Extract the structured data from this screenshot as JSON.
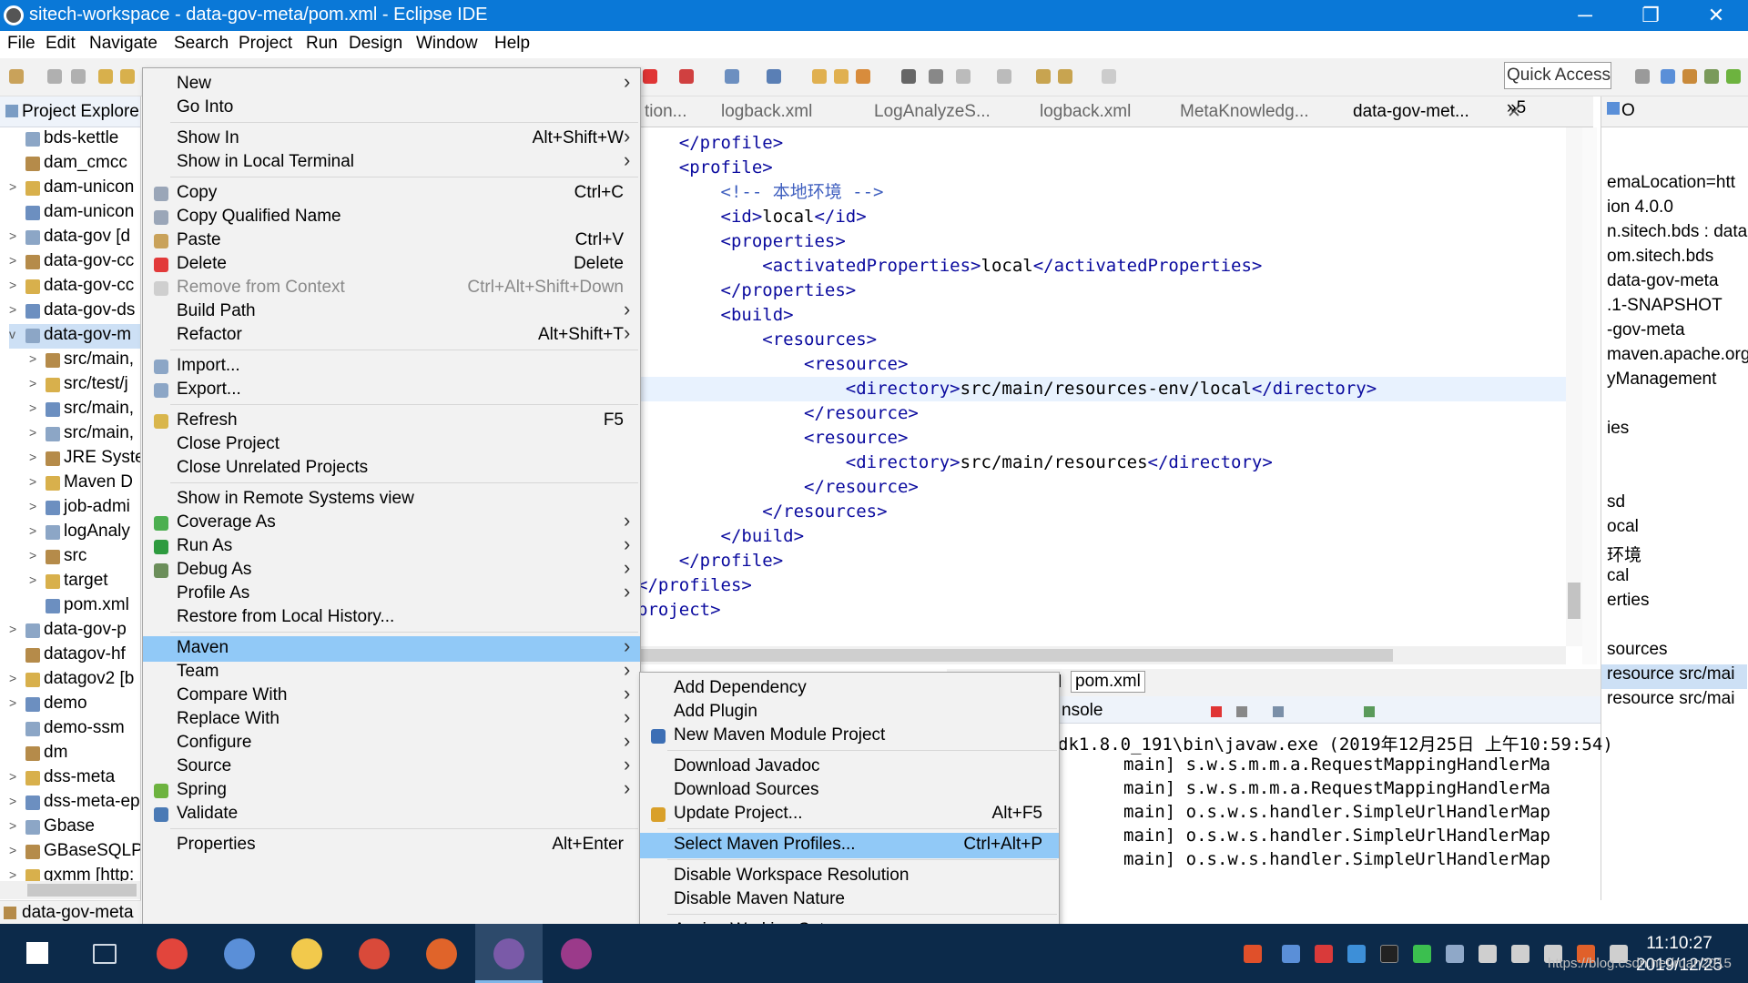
{
  "window": {
    "title": "sitech-workspace - data-gov-meta/pom.xml - Eclipse IDE",
    "minimize_glyph": "─",
    "restore_glyph": "❐",
    "close_glyph": "✕"
  },
  "menubar": [
    "File",
    "Edit",
    "Navigate",
    "Search",
    "Project",
    "Run",
    "Design",
    "Window",
    "Help"
  ],
  "toolbar": {
    "quick_access": "Quick Access"
  },
  "project_explorer": {
    "title": "Project Explore",
    "items": [
      {
        "label": "bds-kettle",
        "arrow": ""
      },
      {
        "label": "dam_cmcc",
        "arrow": ""
      },
      {
        "label": "dam-unicon",
        "arrow": ">"
      },
      {
        "label": "dam-unicon",
        "arrow": ""
      },
      {
        "label": "data-gov [d",
        "arrow": ">"
      },
      {
        "label": "data-gov-cc",
        "arrow": ">"
      },
      {
        "label": "data-gov-cc",
        "arrow": ">"
      },
      {
        "label": "data-gov-ds",
        "arrow": ">"
      },
      {
        "label": "data-gov-m",
        "arrow": "v"
      },
      {
        "label": "src/main,",
        "arrow": ">"
      },
      {
        "label": "src/test/j",
        "arrow": ">"
      },
      {
        "label": "src/main,",
        "arrow": ">"
      },
      {
        "label": "src/main,",
        "arrow": ">"
      },
      {
        "label": "JRE Syste",
        "arrow": ">"
      },
      {
        "label": "Maven D",
        "arrow": ">"
      },
      {
        "label": "job-admi",
        "arrow": ">"
      },
      {
        "label": "logAnaly",
        "arrow": ">"
      },
      {
        "label": "src",
        "arrow": ">"
      },
      {
        "label": "target",
        "arrow": ">"
      },
      {
        "label": "pom.xml",
        "arrow": ""
      },
      {
        "label": "data-gov-p",
        "arrow": ">"
      },
      {
        "label": "datagov-hf",
        "arrow": ""
      },
      {
        "label": "datagov2 [b",
        "arrow": ">"
      },
      {
        "label": "demo",
        "arrow": ">"
      },
      {
        "label": "demo-ssm",
        "arrow": ""
      },
      {
        "label": "dm",
        "arrow": ""
      },
      {
        "label": "dss-meta",
        "arrow": ">"
      },
      {
        "label": "dss-meta-ep",
        "arrow": ">"
      },
      {
        "label": "Gbase",
        "arrow": ">"
      },
      {
        "label": "GBaseSQLPa",
        "arrow": ">"
      },
      {
        "label": "gxmm [http:",
        "arrow": ">"
      }
    ],
    "status": "data-gov-meta"
  },
  "editor": {
    "tabs": [
      "tion...",
      "logback.xml",
      "LogAnalyzeS...",
      "logback.xml",
      "MetaKnowledg...",
      "data-gov-met..."
    ],
    "overflow": "»5",
    "lines": [
      {
        "indent": "    ",
        "parts": [
          [
            "tag",
            "</profile>"
          ]
        ]
      },
      {
        "indent": "    ",
        "parts": [
          [
            "tag",
            "<profile>"
          ]
        ]
      },
      {
        "indent": "        ",
        "parts": [
          [
            "cmt",
            "<!-- 本地环境 -->"
          ]
        ]
      },
      {
        "indent": "        ",
        "parts": [
          [
            "tag",
            "<id>"
          ],
          [
            "txt",
            "local"
          ],
          [
            "tag",
            "</id>"
          ]
        ]
      },
      {
        "indent": "        ",
        "parts": [
          [
            "tag",
            "<properties>"
          ]
        ]
      },
      {
        "indent": "            ",
        "parts": [
          [
            "tag",
            "<activatedProperties>"
          ],
          [
            "txt",
            "local"
          ],
          [
            "tag",
            "</activatedProperties>"
          ]
        ]
      },
      {
        "indent": "        ",
        "parts": [
          [
            "tag",
            "</properties>"
          ]
        ]
      },
      {
        "indent": "        ",
        "parts": [
          [
            "tag",
            "<build>"
          ]
        ]
      },
      {
        "indent": "            ",
        "parts": [
          [
            "tag",
            "<resources>"
          ]
        ]
      },
      {
        "indent": "                ",
        "parts": [
          [
            "tag",
            "<resource>"
          ]
        ]
      },
      {
        "indent": "                    ",
        "parts": [
          [
            "tag",
            "<directory>"
          ],
          [
            "txt",
            "src/main/resources-env/local"
          ],
          [
            "tag",
            "</directory>"
          ]
        ],
        "highlight": true
      },
      {
        "indent": "                ",
        "parts": [
          [
            "tag",
            "</resource>"
          ]
        ]
      },
      {
        "indent": "                ",
        "parts": [
          [
            "tag",
            "<resource>"
          ]
        ]
      },
      {
        "indent": "                    ",
        "parts": [
          [
            "tag",
            "<directory>"
          ],
          [
            "txt",
            "src/main/resources"
          ],
          [
            "tag",
            "</directory>"
          ]
        ]
      },
      {
        "indent": "                ",
        "parts": [
          [
            "tag",
            "</resource>"
          ]
        ]
      },
      {
        "indent": "            ",
        "parts": [
          [
            "tag",
            "</resources>"
          ]
        ]
      },
      {
        "indent": "        ",
        "parts": [
          [
            "tag",
            "</build>"
          ]
        ]
      },
      {
        "indent": "    ",
        "parts": [
          [
            "tag",
            "</profile>"
          ]
        ]
      },
      {
        "indent": "",
        "parts": [
          [
            "tag",
            "</profiles>"
          ]
        ]
      },
      {
        "indent": "",
        "parts": [
          [
            "tag",
            "project>"
          ]
        ]
      }
    ],
    "bottom_tabs": [
      "l",
      "pom.xml"
    ]
  },
  "outline": {
    "tab": "O",
    "items": [
      {
        "label": "emaLocation=htt",
        "row": 0
      },
      {
        "label": "ion  4.0.0",
        "row": 1
      },
      {
        "label": "n.sitech.bds : data",
        "row": 2
      },
      {
        "label": "om.sitech.bds",
        "row": 3
      },
      {
        "label": "data-gov-meta",
        "row": 4
      },
      {
        "label": ".1-SNAPSHOT",
        "row": 5
      },
      {
        "label": "-gov-meta",
        "row": 6
      },
      {
        "label": "maven.apache.org",
        "row": 7
      },
      {
        "label": "yManagement",
        "row": 8
      },
      {
        "label": "ies",
        "row": 10
      },
      {
        "label": "sd",
        "row": 13
      },
      {
        "label": "ocal",
        "row": 14
      },
      {
        "label": "环境",
        "row": 15
      },
      {
        "label": "cal",
        "row": 16
      },
      {
        "label": "erties",
        "row": 17
      },
      {
        "label": "sources",
        "row": 19
      },
      {
        "label": "resource  src/mai",
        "row": 20,
        "selected": true
      },
      {
        "label": "resource  src/mai",
        "row": 21
      }
    ]
  },
  "console": {
    "tab": "nsole",
    "header": "dk1.8.0_191\\bin\\javaw.exe (2019年12月25日 上午10:59:54)",
    "lines": [
      "main] s.w.s.m.m.a.RequestMappingHandlerMa",
      "main] s.w.s.m.m.a.RequestMappingHandlerMa",
      "main] o.s.w.s.handler.SimpleUrlHandlerMap",
      "main] o.s.w.s.handler.SimpleUrlHandlerMap",
      "main] o.s.w.s.handler.SimpleUrlHandlerMap"
    ]
  },
  "context_menu": {
    "items": [
      {
        "label": "New",
        "shortcut": "",
        "submenu": true
      },
      {
        "label": "Go Into",
        "shortcut": ""
      },
      {
        "sep": true
      },
      {
        "label": "Show In",
        "shortcut": "Alt+Shift+W",
        "submenu": true
      },
      {
        "label": "Show in Local Terminal",
        "shortcut": "",
        "submenu": true
      },
      {
        "sep": true
      },
      {
        "label": "Copy",
        "shortcut": "Ctrl+C",
        "icon": "#9aa6b8"
      },
      {
        "label": "Copy Qualified Name",
        "shortcut": "",
        "icon": "#9aa6b8"
      },
      {
        "label": "Paste",
        "shortcut": "Ctrl+V",
        "icon": "#c9a25a"
      },
      {
        "label": "Delete",
        "shortcut": "Delete",
        "icon": "#e23a3a"
      },
      {
        "label": "Remove from Context",
        "shortcut": "Ctrl+Alt+Shift+Down",
        "disabled": true,
        "icon": "#cfcfcf"
      },
      {
        "label": "Build Path",
        "shortcut": "",
        "submenu": true
      },
      {
        "label": "Refactor",
        "shortcut": "Alt+Shift+T",
        "submenu": true
      },
      {
        "sep": true
      },
      {
        "label": "Import...",
        "shortcut": "",
        "icon": "#8ca6c6"
      },
      {
        "label": "Export...",
        "shortcut": "",
        "icon": "#8ca6c6"
      },
      {
        "sep": true
      },
      {
        "label": "Refresh",
        "shortcut": "F5",
        "icon": "#d9b64c"
      },
      {
        "label": "Close Project",
        "shortcut": ""
      },
      {
        "label": "Close Unrelated Projects",
        "shortcut": ""
      },
      {
        "sep": true
      },
      {
        "label": "Show in Remote Systems view",
        "shortcut": ""
      },
      {
        "label": "Coverage As",
        "shortcut": "",
        "submenu": true,
        "icon": "#4caf50"
      },
      {
        "label": "Run As",
        "shortcut": "",
        "submenu": true,
        "icon": "#2e9b3f"
      },
      {
        "label": "Debug As",
        "shortcut": "",
        "submenu": true,
        "icon": "#6b8e5a"
      },
      {
        "label": "Profile As",
        "shortcut": "",
        "submenu": true
      },
      {
        "label": "Restore from Local History...",
        "shortcut": ""
      },
      {
        "sep": true
      },
      {
        "label": "Maven",
        "shortcut": "",
        "submenu": true,
        "highlight": true
      },
      {
        "label": "Team",
        "shortcut": "",
        "submenu": true
      },
      {
        "label": "Compare With",
        "shortcut": "",
        "submenu": true
      },
      {
        "label": "Replace With",
        "shortcut": "",
        "submenu": true
      },
      {
        "label": "Configure",
        "shortcut": "",
        "submenu": true
      },
      {
        "label": "Source",
        "shortcut": "",
        "submenu": true
      },
      {
        "label": "Spring",
        "shortcut": "",
        "submenu": true,
        "icon": "#6db33f"
      },
      {
        "label": "Validate",
        "shortcut": "",
        "icon": "#4a7ab5"
      },
      {
        "sep": true
      },
      {
        "label": "Properties",
        "shortcut": "Alt+Enter"
      }
    ]
  },
  "maven_submenu": {
    "items": [
      {
        "label": "Add Dependency",
        "shortcut": ""
      },
      {
        "label": "Add Plugin",
        "shortcut": ""
      },
      {
        "label": "New Maven Module Project",
        "shortcut": "",
        "icon": "#3d6fb5"
      },
      {
        "sep": true
      },
      {
        "label": "Download Javadoc",
        "shortcut": ""
      },
      {
        "label": "Download Sources",
        "shortcut": ""
      },
      {
        "label": "Update Project...",
        "shortcut": "Alt+F5",
        "icon": "#d9a02a"
      },
      {
        "sep": true
      },
      {
        "label": "Select Maven Profiles...",
        "shortcut": "Ctrl+Alt+P",
        "highlight": true
      },
      {
        "sep": true
      },
      {
        "label": "Disable Workspace Resolution",
        "shortcut": ""
      },
      {
        "label": "Disable Maven Nature",
        "shortcut": ""
      },
      {
        "sep": true
      },
      {
        "label": "Assign Working Sets...",
        "shortcut": ""
      }
    ]
  },
  "taskbar": {
    "apps": [
      {
        "name": "windows-start",
        "color": "#ffffff"
      },
      {
        "name": "task-view",
        "color": "#cfd8e3"
      },
      {
        "name": "chrome",
        "color": "#e2453c"
      },
      {
        "name": "remote-desktop",
        "color": "#5a8fd8"
      },
      {
        "name": "file-explorer",
        "color": "#f2c94c"
      },
      {
        "name": "wps-office",
        "color": "#d94a3a"
      },
      {
        "name": "xmind",
        "color": "#e0642a"
      },
      {
        "name": "eclipse",
        "color": "#7a5aa8",
        "active": true
      },
      {
        "name": "winrar",
        "color": "#9b3a8a"
      }
    ],
    "clock_time": "11:10:27",
    "clock_date": "2019/12/25"
  },
  "watermark": "https://blog.csdn.net/ruan2015"
}
